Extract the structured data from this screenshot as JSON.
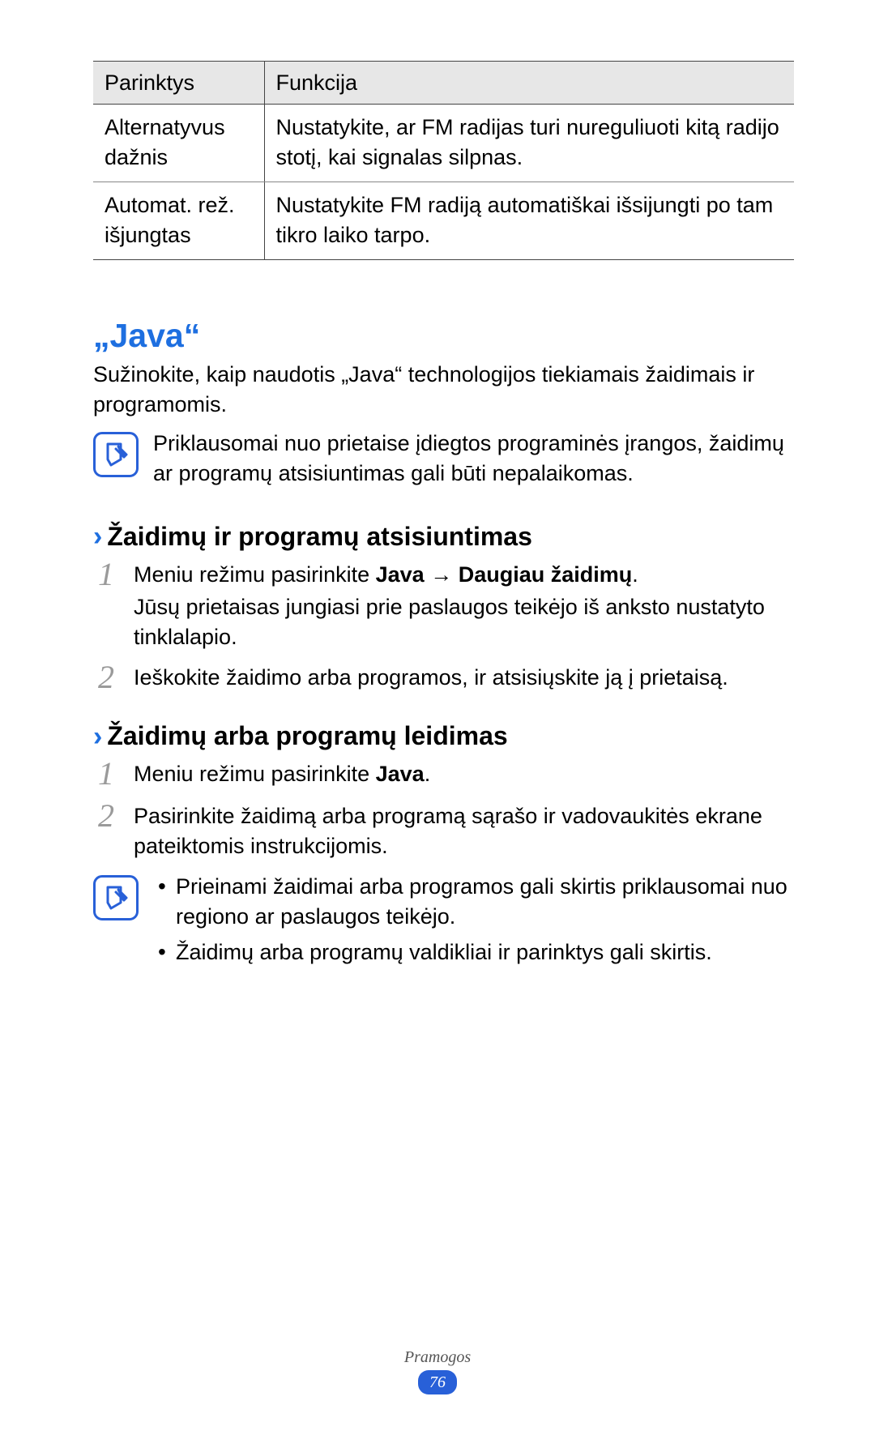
{
  "table": {
    "head_left": "Parinktys",
    "head_right": "Funkcija",
    "rows": [
      {
        "left": "Alternatyvus dažnis",
        "right": "Nustatykite, ar FM radijas turi nureguliuoti kitą radijo stotį, kai signalas silpnas."
      },
      {
        "left": "Automat. rež. išjungtas",
        "right": "Nustatykite FM radiją automatiškai išsijungti po tam tikro laiko tarpo."
      }
    ]
  },
  "heading": "„Java“",
  "intro": "Sužinokite, kaip naudotis „Java“ technologijos tiekiamais žaidimais ir programomis.",
  "note1": "Priklausomai nuo prietaise įdiegtos programinės įrangos, žaidimų ar programų atsisiuntimas gali būti nepalaikomas.",
  "section1": {
    "chev": "›",
    "title": "Žaidimų ir programų atsisiuntimas",
    "step1": {
      "num": "1",
      "before": "Meniu režimu pasirinkite ",
      "bold1": "Java",
      "arrow": " → ",
      "bold2": "Daugiau žaidimų",
      "after": ".",
      "sub": "Jūsų prietaisas jungiasi prie paslaugos teikėjo iš anksto nustatyto tinklalapio."
    },
    "step2": {
      "num": "2",
      "text": "Ieškokite žaidimo arba programos, ir atsisiųskite ją į prietaisą."
    }
  },
  "section2": {
    "chev": "›",
    "title": "Žaidimų arba programų leidimas",
    "step1": {
      "num": "1",
      "before": "Meniu režimu pasirinkite ",
      "bold1": "Java",
      "after": "."
    },
    "step2": {
      "num": "2",
      "text": "Pasirinkite žaidimą arba programą sąrašo ir vadovaukitės ekrane pateiktomis instrukcijomis."
    }
  },
  "note2": {
    "items": [
      "Prieinami žaidimai arba programos gali skirtis priklausomai nuo regiono ar paslaugos teikėjo.",
      "Žaidimų arba programų valdikliai ir parinktys gali skirtis."
    ]
  },
  "footer": {
    "label": "Pramogos",
    "page": "76"
  }
}
